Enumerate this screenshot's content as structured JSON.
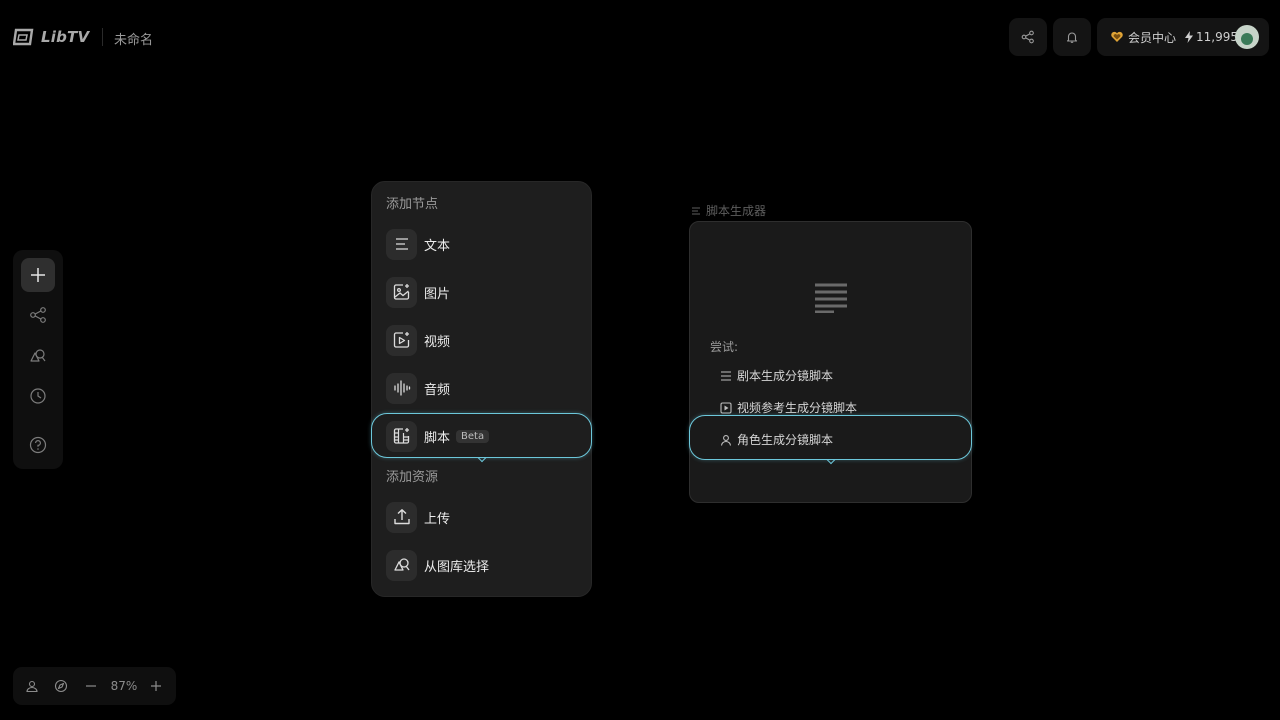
{
  "header": {
    "logo_text": "LibTV",
    "doc_title": "未命名",
    "member_label": "会员中心",
    "credits": "11,995"
  },
  "icons": {
    "share": "share-icon",
    "bell": "bell-icon",
    "heart": "heart-icon",
    "bolt": "bolt-icon"
  },
  "colors": {
    "accent_outline": "#6cc7da",
    "member_heart": "#e0a436"
  },
  "left_toolbar": {
    "items": [
      "plus-icon",
      "workflow-icon",
      "assets-icon",
      "history-icon",
      "help-icon"
    ]
  },
  "bottom_bar": {
    "zoom": "87%"
  },
  "node_panel": {
    "add_node_title": "添加节点",
    "items": [
      {
        "label": "文本"
      },
      {
        "label": "图片"
      },
      {
        "label": "视频"
      },
      {
        "label": "音频"
      },
      {
        "label": "脚本",
        "badge": "Beta"
      }
    ],
    "add_resource_title": "添加资源",
    "resources": [
      {
        "label": "上传"
      },
      {
        "label": "从图库选择"
      }
    ]
  },
  "script_node": {
    "title": "脚本生成器",
    "try_label": "尝试:",
    "suggestions": [
      {
        "label": "剧本生成分镜脚本"
      },
      {
        "label": "视频参考生成分镜脚本"
      },
      {
        "label": "角色生成分镜脚本"
      }
    ]
  }
}
